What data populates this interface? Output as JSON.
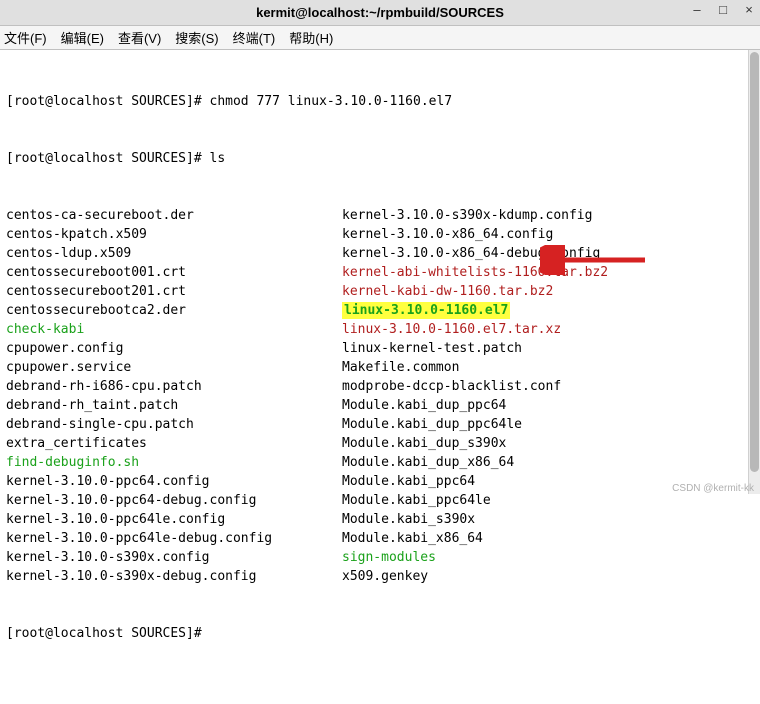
{
  "titlebar": {
    "title": "kermit@localhost:~/rpmbuild/SOURCES"
  },
  "menubar": {
    "file": "文件(F)",
    "edit": "编辑(E)",
    "view": "查看(V)",
    "search": "搜索(S)",
    "terminal": "终端(T)",
    "help": "帮助(H)"
  },
  "prompt": {
    "open": "[root@localhost SOURCES]# ",
    "cmd1": "chmod 777 linux-3.10.0-1160.el7",
    "cmd2": "ls"
  },
  "listing": {
    "left": [
      {
        "text": "centos-ca-secureboot.der",
        "cls": ""
      },
      {
        "text": "centos-kpatch.x509",
        "cls": ""
      },
      {
        "text": "centos-ldup.x509",
        "cls": ""
      },
      {
        "text": "centossecureboot001.crt",
        "cls": ""
      },
      {
        "text": "centossecureboot201.crt",
        "cls": ""
      },
      {
        "text": "centossecurebootca2.der",
        "cls": ""
      },
      {
        "text": "check-kabi",
        "cls": "green"
      },
      {
        "text": "cpupower.config",
        "cls": ""
      },
      {
        "text": "cpupower.service",
        "cls": ""
      },
      {
        "text": "debrand-rh-i686-cpu.patch",
        "cls": ""
      },
      {
        "text": "debrand-rh_taint.patch",
        "cls": ""
      },
      {
        "text": "debrand-single-cpu.patch",
        "cls": ""
      },
      {
        "text": "extra_certificates",
        "cls": ""
      },
      {
        "text": "find-debuginfo.sh",
        "cls": "green"
      },
      {
        "text": "kernel-3.10.0-ppc64.config",
        "cls": ""
      },
      {
        "text": "kernel-3.10.0-ppc64-debug.config",
        "cls": ""
      },
      {
        "text": "kernel-3.10.0-ppc64le.config",
        "cls": ""
      },
      {
        "text": "kernel-3.10.0-ppc64le-debug.config",
        "cls": ""
      },
      {
        "text": "kernel-3.10.0-s390x.config",
        "cls": ""
      },
      {
        "text": "kernel-3.10.0-s390x-debug.config",
        "cls": ""
      }
    ],
    "right": [
      {
        "text": "kernel-3.10.0-s390x-kdump.config",
        "cls": ""
      },
      {
        "text": "kernel-3.10.0-x86_64.config",
        "cls": ""
      },
      {
        "text": "kernel-3.10.0-x86_64-debug.config",
        "cls": ""
      },
      {
        "text": "kernel-abi-whitelists-1160.tar.bz2",
        "cls": "red"
      },
      {
        "text": "kernel-kabi-dw-1160.tar.bz2",
        "cls": "red"
      },
      {
        "text": "linux-3.10.0-1160.el7",
        "cls": "highlight"
      },
      {
        "text": "linux-3.10.0-1160.el7.tar.xz",
        "cls": "red"
      },
      {
        "text": "linux-kernel-test.patch",
        "cls": ""
      },
      {
        "text": "Makefile.common",
        "cls": ""
      },
      {
        "text": "modprobe-dccp-blacklist.conf",
        "cls": ""
      },
      {
        "text": "Module.kabi_dup_ppc64",
        "cls": ""
      },
      {
        "text": "Module.kabi_dup_ppc64le",
        "cls": ""
      },
      {
        "text": "Module.kabi_dup_s390x",
        "cls": ""
      },
      {
        "text": "Module.kabi_dup_x86_64",
        "cls": ""
      },
      {
        "text": "Module.kabi_ppc64",
        "cls": ""
      },
      {
        "text": "Module.kabi_ppc64le",
        "cls": ""
      },
      {
        "text": "Module.kabi_s390x",
        "cls": ""
      },
      {
        "text": "Module.kabi_x86_64",
        "cls": ""
      },
      {
        "text": "sign-modules",
        "cls": "green"
      },
      {
        "text": "x509.genkey",
        "cls": ""
      }
    ]
  },
  "watermark": "CSDN @kermit-kk"
}
